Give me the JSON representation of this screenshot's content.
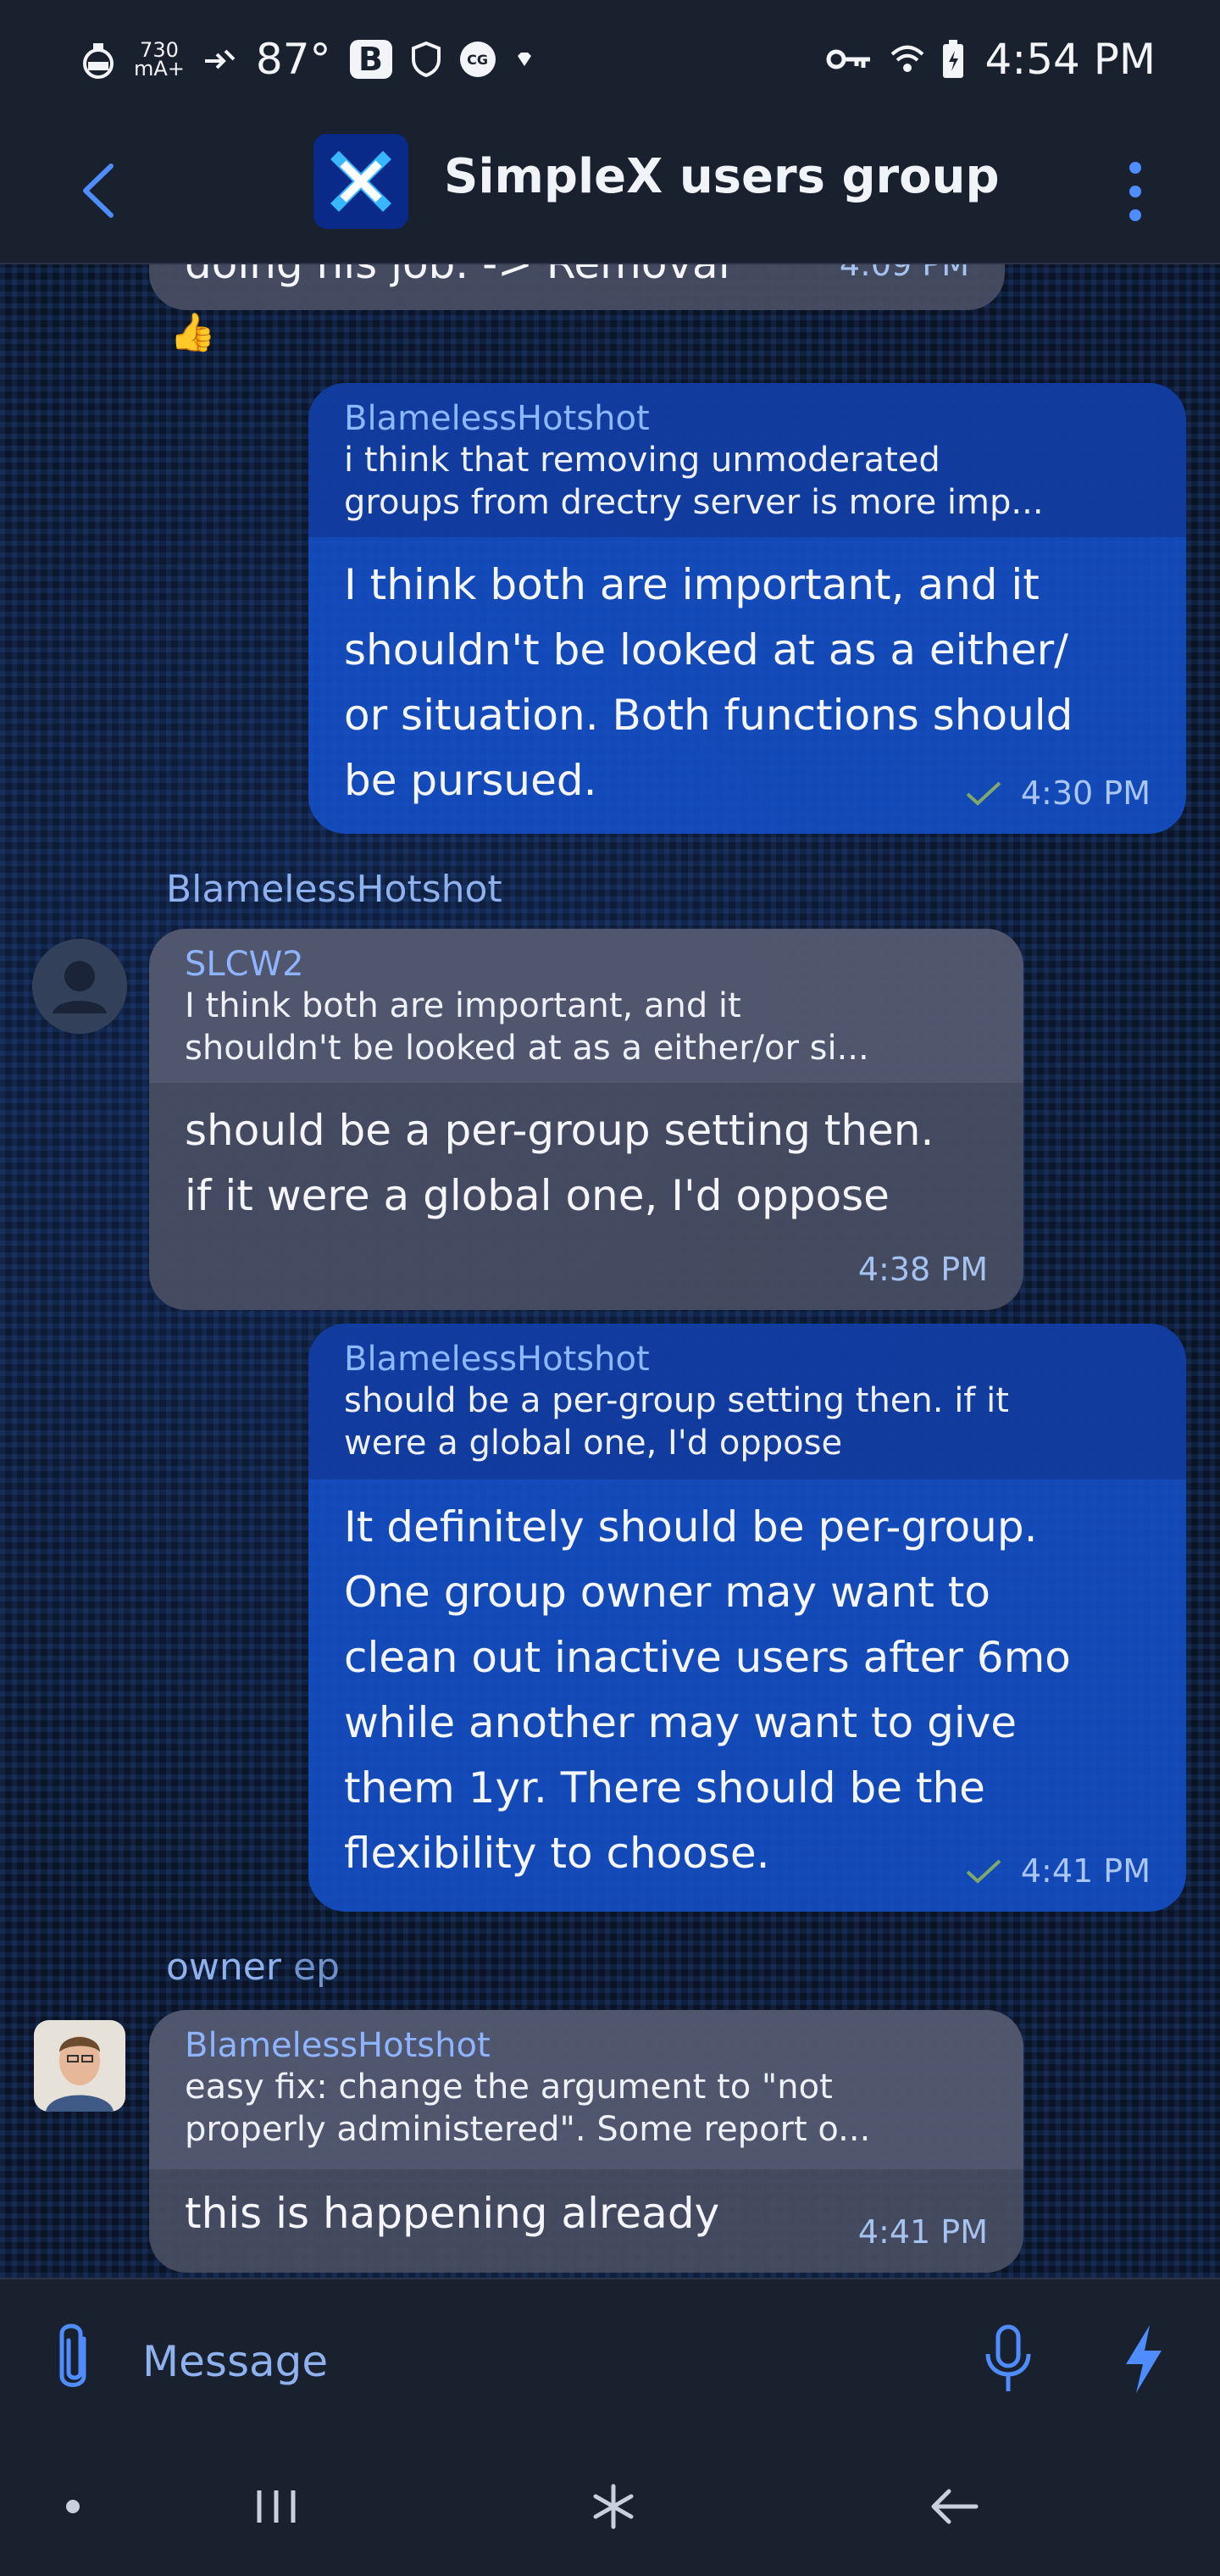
{
  "status_bar": {
    "data_rate_top": "730",
    "data_rate_bottom": "mA+",
    "temperature": "87°",
    "b_badge": "B",
    "cg_badge": "CG",
    "time": "4:54 PM"
  },
  "header": {
    "title": "SimpleX users group",
    "avatar_icon": "simplex-logo-icon",
    "back_icon": "chevron-left-icon",
    "menu_icon": "more-vert-icon"
  },
  "messages": [
    {
      "direction": "in",
      "partial_text": "doing his job. -> Removal",
      "time": "4:09 PM"
    },
    {
      "direction": "reaction",
      "emoji": "👍"
    },
    {
      "direction": "out",
      "quote_author": "BlamelessHotshot",
      "quote_line1": "i think that removing unmoderated",
      "quote_line2": "groups from drectry server is more imp...",
      "body_lines": [
        "I think both are important, and it",
        "shouldn't be looked at as a either/",
        "or situation. Both functions should",
        "be pursued."
      ],
      "time": "4:30 PM",
      "status": "sent"
    },
    {
      "direction": "in",
      "sender": "BlamelessHotshot",
      "quote_author": "SLCW2",
      "quote_line1": "I think both are important, and it",
      "quote_line2": "shouldn't be looked at as a either/or si...",
      "body_lines": [
        "should be a per-group setting then.",
        "if it were a global one, I'd oppose"
      ],
      "time": "4:38 PM"
    },
    {
      "direction": "out",
      "quote_author": "BlamelessHotshot",
      "quote_line1": "should be a per-group setting then. if it",
      "quote_line2": "were a global one, I'd oppose",
      "body_lines": [
        "It definitely should be per-group.",
        "One group owner may want to",
        "clean out inactive users after 6mo",
        "while another may want to give",
        "them 1yr. There should be the",
        "flexibility to choose."
      ],
      "time": "4:41 PM",
      "status": "sent"
    },
    {
      "direction": "in",
      "sender_role": "owner",
      "sender": "ep",
      "quote_author": "BlamelessHotshot",
      "quote_line1": "easy fix: change the argument to \"not",
      "quote_line2": "properly administered\". Some report o...",
      "body_lines": [
        "this is happening already"
      ],
      "time": "4:41 PM"
    }
  ],
  "composer": {
    "placeholder": "Message",
    "attach_icon": "paperclip-icon",
    "mic_icon": "microphone-icon",
    "bolt_icon": "lightning-icon"
  },
  "nav_bar": {
    "items": [
      "dot-icon",
      "recent-apps-icon",
      "home-icon",
      "back-arrow-icon"
    ]
  }
}
